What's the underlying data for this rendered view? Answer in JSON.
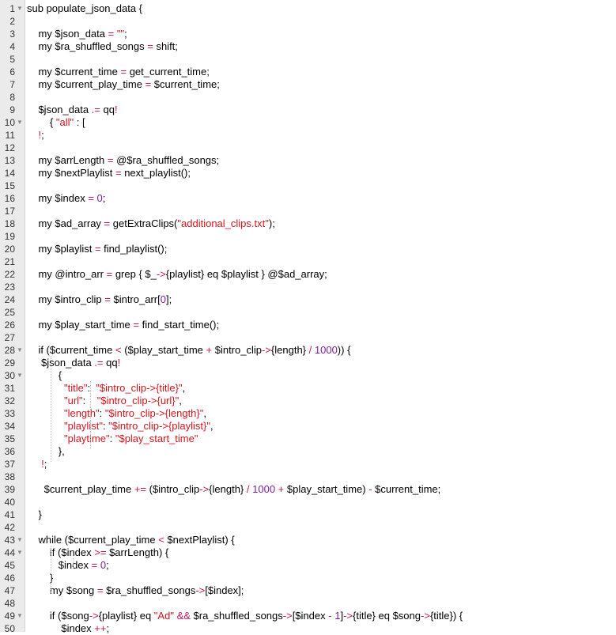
{
  "editor": {
    "lines": [
      {
        "n": "1",
        "fold": true,
        "t": "sub populate_json_data {"
      },
      {
        "n": "2",
        "t": ""
      },
      {
        "n": "3",
        "t": "    my $json_data = \"\";"
      },
      {
        "n": "4",
        "t": "    my $ra_shuffled_songs = shift;"
      },
      {
        "n": "5",
        "t": ""
      },
      {
        "n": "6",
        "t": "    my $current_time = get_current_time;"
      },
      {
        "n": "7",
        "t": "    my $current_play_time = $current_time;"
      },
      {
        "n": "8",
        "t": ""
      },
      {
        "n": "9",
        "t": "    $json_data .= qq!"
      },
      {
        "n": "10",
        "fold": true,
        "t": "        { \"all\" : ["
      },
      {
        "n": "11",
        "t": "    !;"
      },
      {
        "n": "12",
        "t": ""
      },
      {
        "n": "13",
        "t": "    my $arrLength = @$ra_shuffled_songs;"
      },
      {
        "n": "14",
        "t": "    my $nextPlaylist = next_playlist();"
      },
      {
        "n": "15",
        "t": ""
      },
      {
        "n": "16",
        "t": "    my $index = 0;"
      },
      {
        "n": "17",
        "t": ""
      },
      {
        "n": "18",
        "t": "    my $ad_array = getExtraClips(\"additional_clips.txt\");"
      },
      {
        "n": "19",
        "t": ""
      },
      {
        "n": "20",
        "t": "    my $playlist = find_playlist();"
      },
      {
        "n": "21",
        "t": ""
      },
      {
        "n": "22",
        "t": "    my @intro_arr = grep { $_->{playlist} eq $playlist } @$ad_array;"
      },
      {
        "n": "23",
        "t": ""
      },
      {
        "n": "24",
        "t": "    my $intro_clip = $intro_arr[0];"
      },
      {
        "n": "25",
        "t": ""
      },
      {
        "n": "26",
        "t": "    my $play_start_time = find_start_time();"
      },
      {
        "n": "27",
        "t": ""
      },
      {
        "n": "28",
        "fold": true,
        "t": "    if ($current_time < ($play_start_time + $intro_clip->{length} / 1000)) {"
      },
      {
        "n": "29",
        "t": "     $json_data .= qq!"
      },
      {
        "n": "30",
        "fold": true,
        "t": "           {"
      },
      {
        "n": "31",
        "t": "             \"title\":  \"$intro_clip->{title}\","
      },
      {
        "n": "32",
        "t": "             \"url\":    \"$intro_clip->{url}\","
      },
      {
        "n": "33",
        "t": "             \"length\": \"$intro_clip->{length}\","
      },
      {
        "n": "34",
        "t": "             \"playlist\": \"$intro_clip->{playlist}\","
      },
      {
        "n": "35",
        "t": "             \"playtime\": \"$play_start_time\""
      },
      {
        "n": "36",
        "t": "           },"
      },
      {
        "n": "37",
        "t": "     !;"
      },
      {
        "n": "38",
        "t": ""
      },
      {
        "n": "39",
        "t": "      $current_play_time += ($intro_clip->{length} / 1000 + $play_start_time) - $current_time;"
      },
      {
        "n": "40",
        "t": ""
      },
      {
        "n": "41",
        "t": "    }"
      },
      {
        "n": "42",
        "t": ""
      },
      {
        "n": "43",
        "fold": true,
        "t": "    while ($current_play_time < $nextPlaylist) {"
      },
      {
        "n": "44",
        "fold": true,
        "t": "        if ($index >= $arrLength) {"
      },
      {
        "n": "45",
        "t": "           $index = 0;"
      },
      {
        "n": "46",
        "t": "        }"
      },
      {
        "n": "47",
        "t": "        my $song = $ra_shuffled_songs->[$index];"
      },
      {
        "n": "48",
        "t": ""
      },
      {
        "n": "49",
        "fold": true,
        "t": "        if ($song->{playlist} eq \"Ad\" && $ra_shuffled_songs->[$index - 1]->{title} eq $song->{title}) {"
      },
      {
        "n": "50",
        "t": "            $index ++;"
      }
    ],
    "colors": {
      "string": "#d2151f",
      "operator": "#c2185b",
      "number": "#7b1fa2",
      "gutter": "#ebebeb"
    },
    "fold_icon": "chevron-down-icon"
  }
}
